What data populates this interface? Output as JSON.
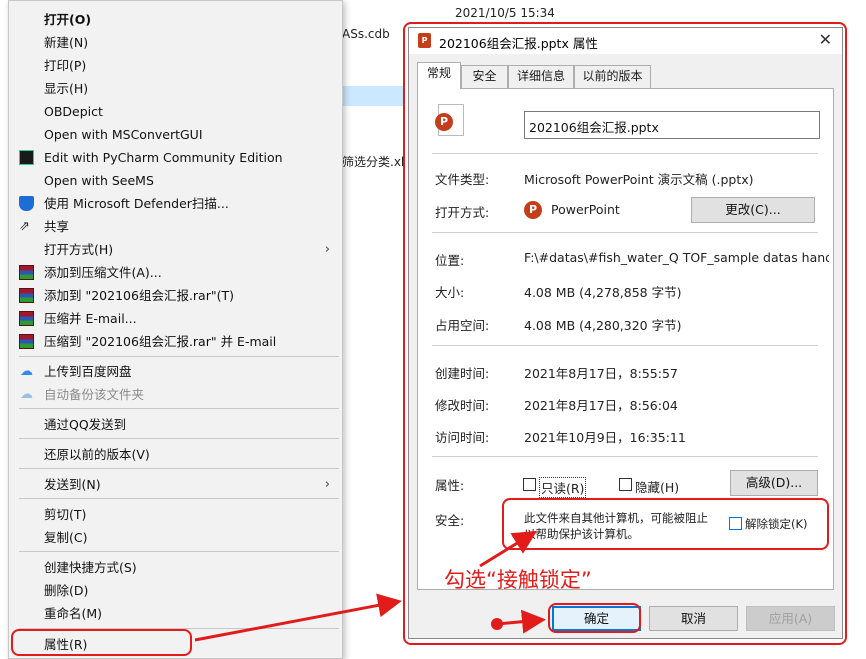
{
  "explorer": {
    "date_text": "2021/10/5 15:34",
    "file_frag_1": "ASs.cdb",
    "file_frag_2": "筛选分类.xl"
  },
  "context_menu": {
    "items": [
      {
        "label": "打开(O)"
      },
      {
        "label": "新建(N)"
      },
      {
        "label": "打印(P)"
      },
      {
        "label": "显示(H)"
      },
      {
        "label": "OBDepict"
      },
      {
        "label": "Open with MSConvertGUI"
      },
      {
        "label": "Edit with PyCharm Community Edition"
      },
      {
        "label": "Open with SeeMS"
      },
      {
        "label": "使用 Microsoft Defender扫描..."
      },
      {
        "label": "共享"
      },
      {
        "label": "打开方式(H)"
      },
      {
        "label": "添加到压缩文件(A)..."
      },
      {
        "label": "添加到 \"202106组会汇报.rar\"(T)"
      },
      {
        "label": "压缩并 E-mail..."
      },
      {
        "label": "压缩到 \"202106组会汇报.rar\" 并 E-mail"
      },
      {
        "label": "上传到百度网盘"
      },
      {
        "label": "自动备份该文件夹"
      },
      {
        "label": "通过QQ发送到"
      },
      {
        "label": "还原以前的版本(V)"
      },
      {
        "label": "发送到(N)"
      },
      {
        "label": "剪切(T)"
      },
      {
        "label": "复制(C)"
      },
      {
        "label": "创建快捷方式(S)"
      },
      {
        "label": "删除(D)"
      },
      {
        "label": "重命名(M)"
      },
      {
        "label": "属性(R)"
      }
    ]
  },
  "dialog": {
    "title": "202106组会汇报.pptx 属性",
    "close": "✕",
    "tabs": [
      "常规",
      "安全",
      "详细信息",
      "以前的版本"
    ],
    "filename": "202106组会汇报.pptx",
    "file_type_label": "文件类型:",
    "file_type_value": "Microsoft PowerPoint 演示文稿 (.pptx)",
    "open_with_label": "打开方式:",
    "open_with_value": "PowerPoint",
    "change_button": "更改(C)...",
    "location_label": "位置:",
    "location_value": "F:\\#datas\\#fish_water_Q TOF_sample datas handle",
    "size_label": "大小:",
    "size_value": "4.08 MB (4,278,858 字节)",
    "disk_label": "占用空间:",
    "disk_value": "4.08 MB (4,280,320 字节)",
    "created_label": "创建时间:",
    "created_value": "2021年8月17日，8:55:57",
    "modified_label": "修改时间:",
    "modified_value": "2021年8月17日，8:56:04",
    "accessed_label": "访问时间:",
    "accessed_value": "2021年10月9日，16:35:11",
    "attrs_label": "属性:",
    "readonly_label": "只读(R)",
    "hidden_label": "隐藏(H)",
    "advanced_button": "高级(D)...",
    "security_label": "安全:",
    "security_text_1": "此文件来自其他计算机，可能被阻止",
    "security_text_2": "以帮助保护该计算机。",
    "unblock_label": "解除锁定(K)",
    "ok_button": "确定",
    "cancel_button": "取消",
    "apply_button": "应用(A)"
  },
  "annotation": {
    "note": "勾选“接触锁定”",
    "color": "#e21b1b"
  }
}
